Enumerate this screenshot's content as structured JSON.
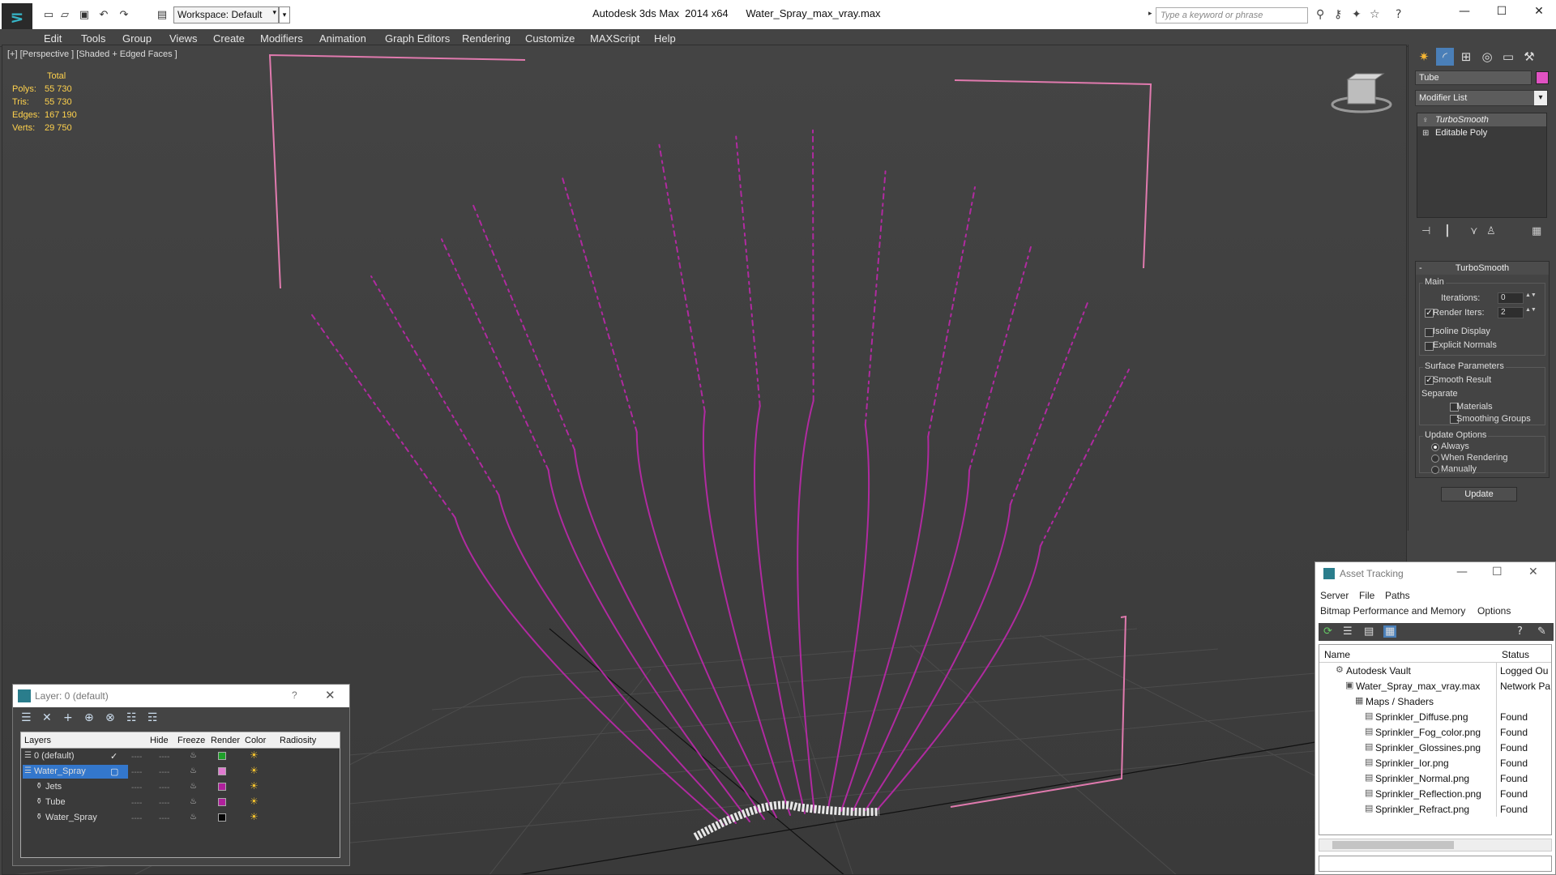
{
  "titlebar": {
    "workspace": "Workspace: Default",
    "app_title": "Autodesk 3ds Max  2014 x64",
    "file_name": "Water_Spray_max_vray.max",
    "search_placeholder": "Type a keyword or phrase"
  },
  "menu": [
    "Edit",
    "Tools",
    "Group",
    "Views",
    "Create",
    "Modifiers",
    "Animation",
    "Graph Editors",
    "Rendering",
    "Customize",
    "MAXScript",
    "Help"
  ],
  "viewport": {
    "label": "[+] [Perspective ] [Shaded + Edged Faces ]",
    "stats": {
      "header": "Total",
      "rows": [
        {
          "k": "Polys:",
          "v": "55 730"
        },
        {
          "k": "Tris:",
          "v": "55 730"
        },
        {
          "k": "Edges:",
          "v": "167 190"
        },
        {
          "k": "Verts:",
          "v": "29 750"
        }
      ]
    },
    "spray_color": "#b02aa0",
    "frame_color": "#e07aae"
  },
  "command_panel": {
    "object_name": "Tube",
    "object_color": "#e052c2",
    "modifier_list": "Modifier List",
    "stack": [
      "TurboSmooth",
      "Editable Poly"
    ],
    "rollout_title": "TurboSmooth",
    "main_group": "Main",
    "iterations_label": "Iterations:",
    "iterations_value": "0",
    "render_iters_label": "Render Iters:",
    "render_iters_value": "2",
    "isoline_label": "Isoline Display",
    "explicit_label": "Explicit Normals",
    "surface_group": "Surface Parameters",
    "smooth_result_label": "Smooth Result",
    "separate_label": "Separate",
    "materials_label": "Materials",
    "smoothing_groups_label": "Smoothing Groups",
    "update_group": "Update Options",
    "always_label": "Always",
    "when_rendering_label": "When Rendering",
    "manually_label": "Manually",
    "update_button": "Update"
  },
  "layer_dialog": {
    "title": "Layer: 0 (default)",
    "help": "?",
    "columns": [
      "Layers",
      "Hide",
      "Freeze",
      "Render",
      "Color",
      "Radiosity"
    ],
    "rows": [
      {
        "name": "0 (default)",
        "color": "#1fa02a",
        "indent": 0,
        "current": true
      },
      {
        "name": "Water_Spray",
        "color": "#e07ad0",
        "indent": 0,
        "selected": true
      },
      {
        "name": "Jets",
        "color": "#b0209c",
        "indent": 1
      },
      {
        "name": "Tube",
        "color": "#b0209c",
        "indent": 1
      },
      {
        "name": "Water_Spray",
        "color": "#050505",
        "indent": 1
      }
    ]
  },
  "asset_dialog": {
    "title": "Asset Tracking",
    "menu1": [
      "Server",
      "File",
      "Paths"
    ],
    "menu2": [
      "Bitmap Performance and Memory",
      "Options"
    ],
    "col_name": "Name",
    "col_status": "Status",
    "rows": [
      {
        "name": "Autodesk Vault",
        "status": "Logged Ou",
        "indent": 0
      },
      {
        "name": "Water_Spray_max_vray.max",
        "status": "Network Pa",
        "indent": 1
      },
      {
        "name": "Maps / Shaders",
        "status": "",
        "indent": 2
      },
      {
        "name": "Sprinkler_Diffuse.png",
        "status": "Found",
        "indent": 3
      },
      {
        "name": "Sprinkler_Fog_color.png",
        "status": "Found",
        "indent": 3
      },
      {
        "name": "Sprinkler_Glossines.png",
        "status": "Found",
        "indent": 3
      },
      {
        "name": "Sprinkler_Ior.png",
        "status": "Found",
        "indent": 3
      },
      {
        "name": "Sprinkler_Normal.png",
        "status": "Found",
        "indent": 3
      },
      {
        "name": "Sprinkler_Reflection.png",
        "status": "Found",
        "indent": 3
      },
      {
        "name": "Sprinkler_Refract.png",
        "status": "Found",
        "indent": 3
      }
    ]
  }
}
